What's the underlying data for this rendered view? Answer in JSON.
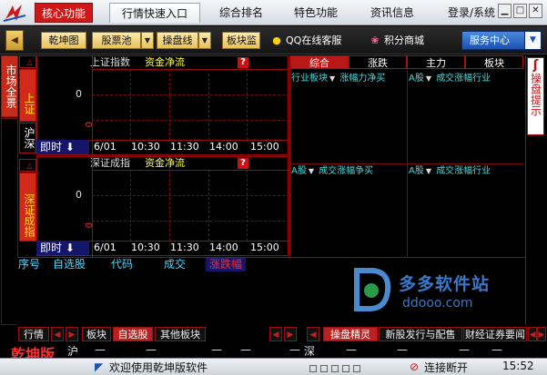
{
  "menubar": {
    "items": [
      "核心功能",
      "行情快速入口",
      "综合排名",
      "特色功能",
      "资讯信息",
      "登录/系统"
    ]
  },
  "toolbar": {
    "back": "◀",
    "buttons": [
      "乾坤图",
      "股票池",
      "操盘线",
      "板块监"
    ],
    "qq": "QQ在线客服",
    "points": "积分商城",
    "service": "服务中心"
  },
  "left_tabs": [
    "市场全景",
    "上证",
    "沪深",
    "深证成指"
  ],
  "panel1": {
    "title": "上证指数",
    "subtitle": "资金净流",
    "zero": "0",
    "zero_b": "0",
    "time_select": "即时",
    "times": [
      "6/01",
      "10:30",
      "11:30",
      "14:00",
      "15:00"
    ]
  },
  "panel2": {
    "title": "深证成指",
    "subtitle": "资金净流",
    "zero": "0",
    "zero_b": "0",
    "time_select": "即时",
    "times": [
      "6/01",
      "10:30",
      "11:30",
      "14:00",
      "15:00"
    ]
  },
  "right_tabs": [
    "综合",
    "涨跌",
    "主力",
    "板块"
  ],
  "right_lists": {
    "row1": [
      {
        "a": "行业板块",
        "b": "涨幅力净买"
      },
      {
        "a": "A股",
        "b": "成交涨幅行业"
      }
    ],
    "row2": [
      {
        "a": "A股",
        "b": "成交涨幅争买"
      },
      {
        "a": "A股",
        "b": "成交涨幅行业"
      }
    ]
  },
  "side_right_tab": "操盘提示",
  "watchlist": {
    "columns": [
      "序号",
      "自选股",
      "代码",
      "成交",
      "涨跌幅"
    ]
  },
  "bottom_tabs": [
    "行情",
    "板块",
    "自选股",
    "其他板块",
    "操盘精灵",
    "新股发行与配售",
    "财经证券要闻"
  ],
  "brand": "乾坤版",
  "ticker": {
    "sh": "沪",
    "sz": "深",
    "dash": "—"
  },
  "status": {
    "welcome": "欢迎使用乾坤版软件",
    "connect": "连接断开",
    "time": "15:52"
  },
  "watermark": {
    "name": "多多软件站",
    "url": "ddooo.com"
  }
}
